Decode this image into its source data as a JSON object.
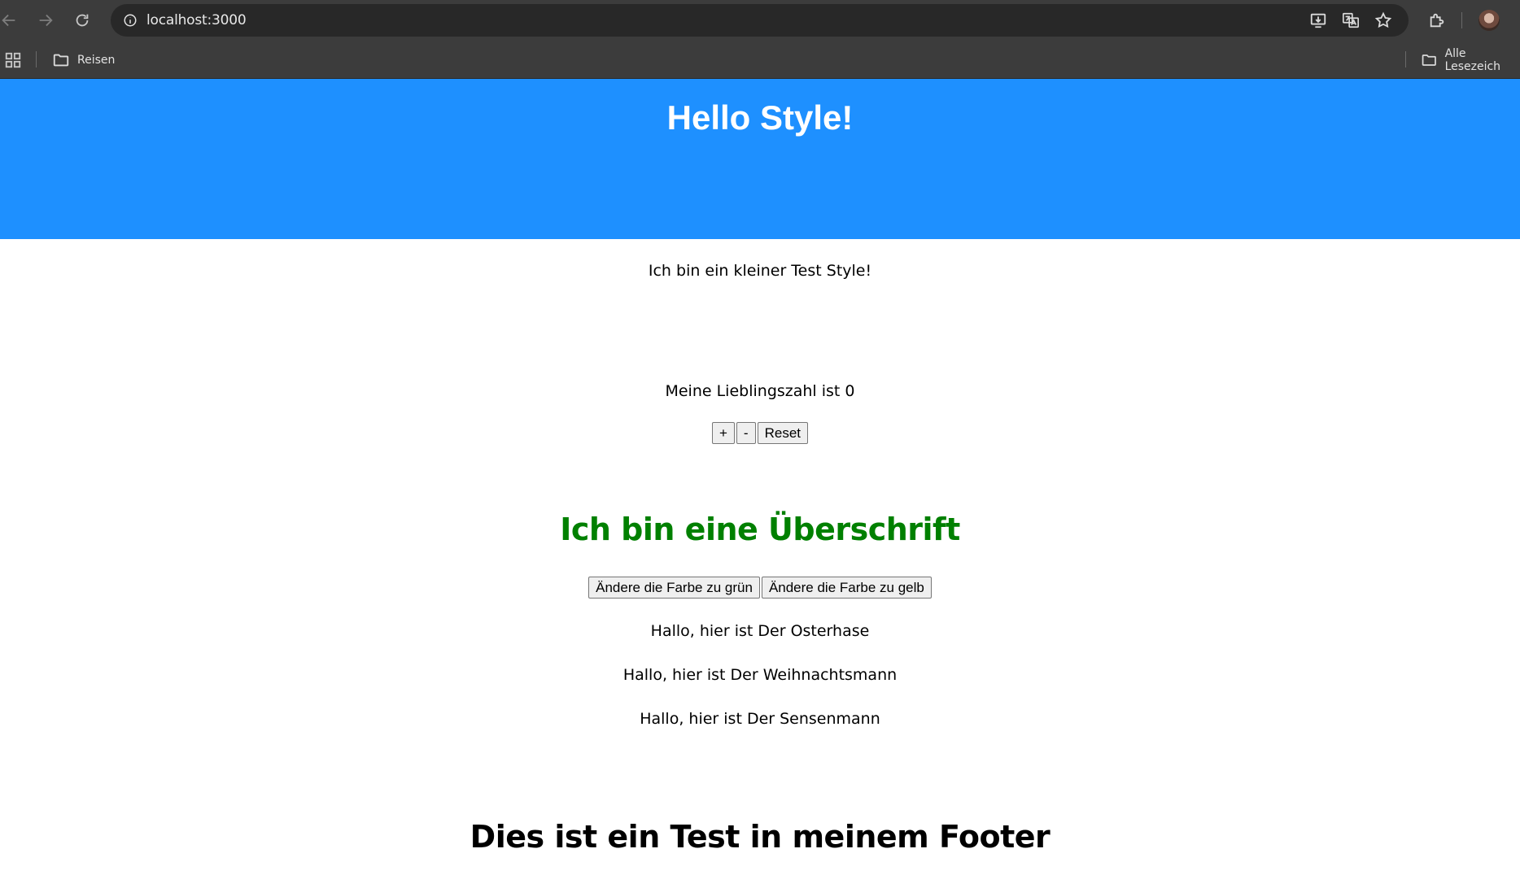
{
  "browser": {
    "url": "localhost:3000",
    "bookmarks": {
      "folder_left": "Reisen",
      "folder_right": "Alle Lesezeich"
    },
    "icons": [
      "back-icon",
      "forward-icon",
      "reload-icon",
      "site-info-icon",
      "install-icon",
      "translate-icon",
      "star-icon",
      "extensions-icon",
      "apps-icon",
      "folder-icon"
    ]
  },
  "page": {
    "hero_title": "Hello Style!",
    "intro_text": "Ich bin ein kleiner Test Style!",
    "counter": {
      "text": "Meine Lieblingszahl ist 0",
      "plus_label": "+",
      "minus_label": "-",
      "reset_label": "Reset"
    },
    "heading": {
      "text": "Ich bin eine Überschrift",
      "color": "#008000",
      "green_button": "Ändere die Farbe zu grün",
      "yellow_button": "Ändere die Farbe zu gelb"
    },
    "greetings": [
      "Hallo, hier ist Der Osterhase",
      "Hallo, hier ist Der Weihnachtsmann",
      "Hallo, hier ist Der Sensenmann"
    ],
    "footer_text": "Dies ist ein Test in meinem Footer"
  },
  "colors": {
    "hero_bg": "#1e90ff",
    "chrome_bg": "#3c3c3c",
    "omnibox_bg": "#282828"
  }
}
